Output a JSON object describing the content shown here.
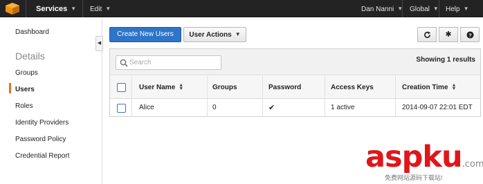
{
  "topbar": {
    "logo_icon": "aws-cube-icon",
    "services_label": "Services",
    "edit_label": "Edit",
    "user_label": "Dan Nanni",
    "region_label": "Global",
    "help_label": "Help"
  },
  "sidebar": {
    "dashboard": "Dashboard",
    "section_heading": "Details",
    "items": [
      "Groups",
      "Users",
      "Roles",
      "Identity Providers",
      "Password Policy",
      "Credential Report"
    ],
    "active_item": "Users",
    "active_color": "#e4731c"
  },
  "toolbar": {
    "create_label": "Create New Users",
    "actions_label": "User Actions",
    "refresh_icon": "refresh-icon",
    "settings_icon": "gear-icon",
    "help_icon": "help-icon",
    "primary_color": "#2e74c8"
  },
  "search": {
    "placeholder": "Search"
  },
  "results": {
    "showing_text": "Showing 1 results"
  },
  "table": {
    "columns": [
      "User Name",
      "Groups",
      "Password",
      "Access Keys",
      "Creation Time"
    ],
    "rows": [
      {
        "user_name": "Alice",
        "groups": "0",
        "password": "✔",
        "access_keys": "1 active",
        "creation_time": "2014-09-07 22:01 EDT"
      }
    ]
  },
  "watermark": {
    "text": "aspku",
    "suffix": ".com",
    "subtitle": "免费网站源码下载站!"
  }
}
